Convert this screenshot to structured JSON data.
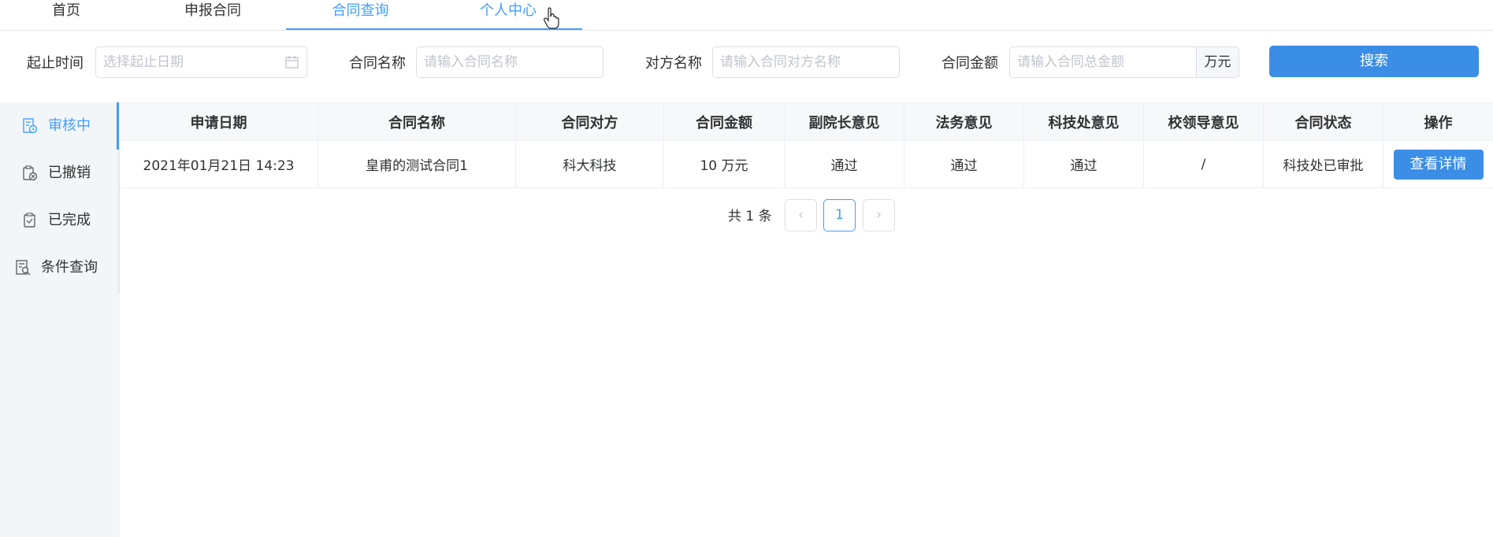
{
  "nav": {
    "items": [
      {
        "label": "首页"
      },
      {
        "label": "申报合同"
      },
      {
        "label": "合同查询"
      },
      {
        "label": "个人中心"
      }
    ]
  },
  "filters": {
    "date_label": "起止时间",
    "date_placeholder": "选择起止日期",
    "name_label": "合同名称",
    "name_placeholder": "请输入合同名称",
    "party_label": "对方名称",
    "party_placeholder": "请输入合同对方名称",
    "amount_label": "合同金额",
    "amount_placeholder": "请输入合同总金额",
    "amount_unit": "万元",
    "search_label": "搜索"
  },
  "sidebar": {
    "items": [
      {
        "label": "审核中",
        "icon": "document-clock-icon"
      },
      {
        "label": "已撤销",
        "icon": "cancel-clipboard-icon"
      },
      {
        "label": "已完成",
        "icon": "check-clipboard-icon"
      },
      {
        "label": "条件查询",
        "icon": "search-document-icon"
      }
    ],
    "active_color": "#409eff"
  },
  "table": {
    "headers": [
      "申请日期",
      "合同名称",
      "合同对方",
      "合同金额",
      "副院长意见",
      "法务意见",
      "科技处意见",
      "校领导意见",
      "合同状态",
      "操作"
    ],
    "rows": [
      {
        "date": "2021年01月21日 14:23",
        "name": "皇甫的测试合同1",
        "party": "科大科技",
        "amount": "10 万元",
        "vp_opinion": "通过",
        "legal_opinion": "通过",
        "tech_opinion": "通过",
        "leader_opinion": "/",
        "status": "科技处已审批",
        "action": "查看详情"
      }
    ]
  },
  "pagination": {
    "total_text": "共 1 条",
    "current_page": "1",
    "prev": "‹",
    "next": "›"
  },
  "colors": {
    "accent": "#409eff",
    "button": "#3a8ee6"
  }
}
